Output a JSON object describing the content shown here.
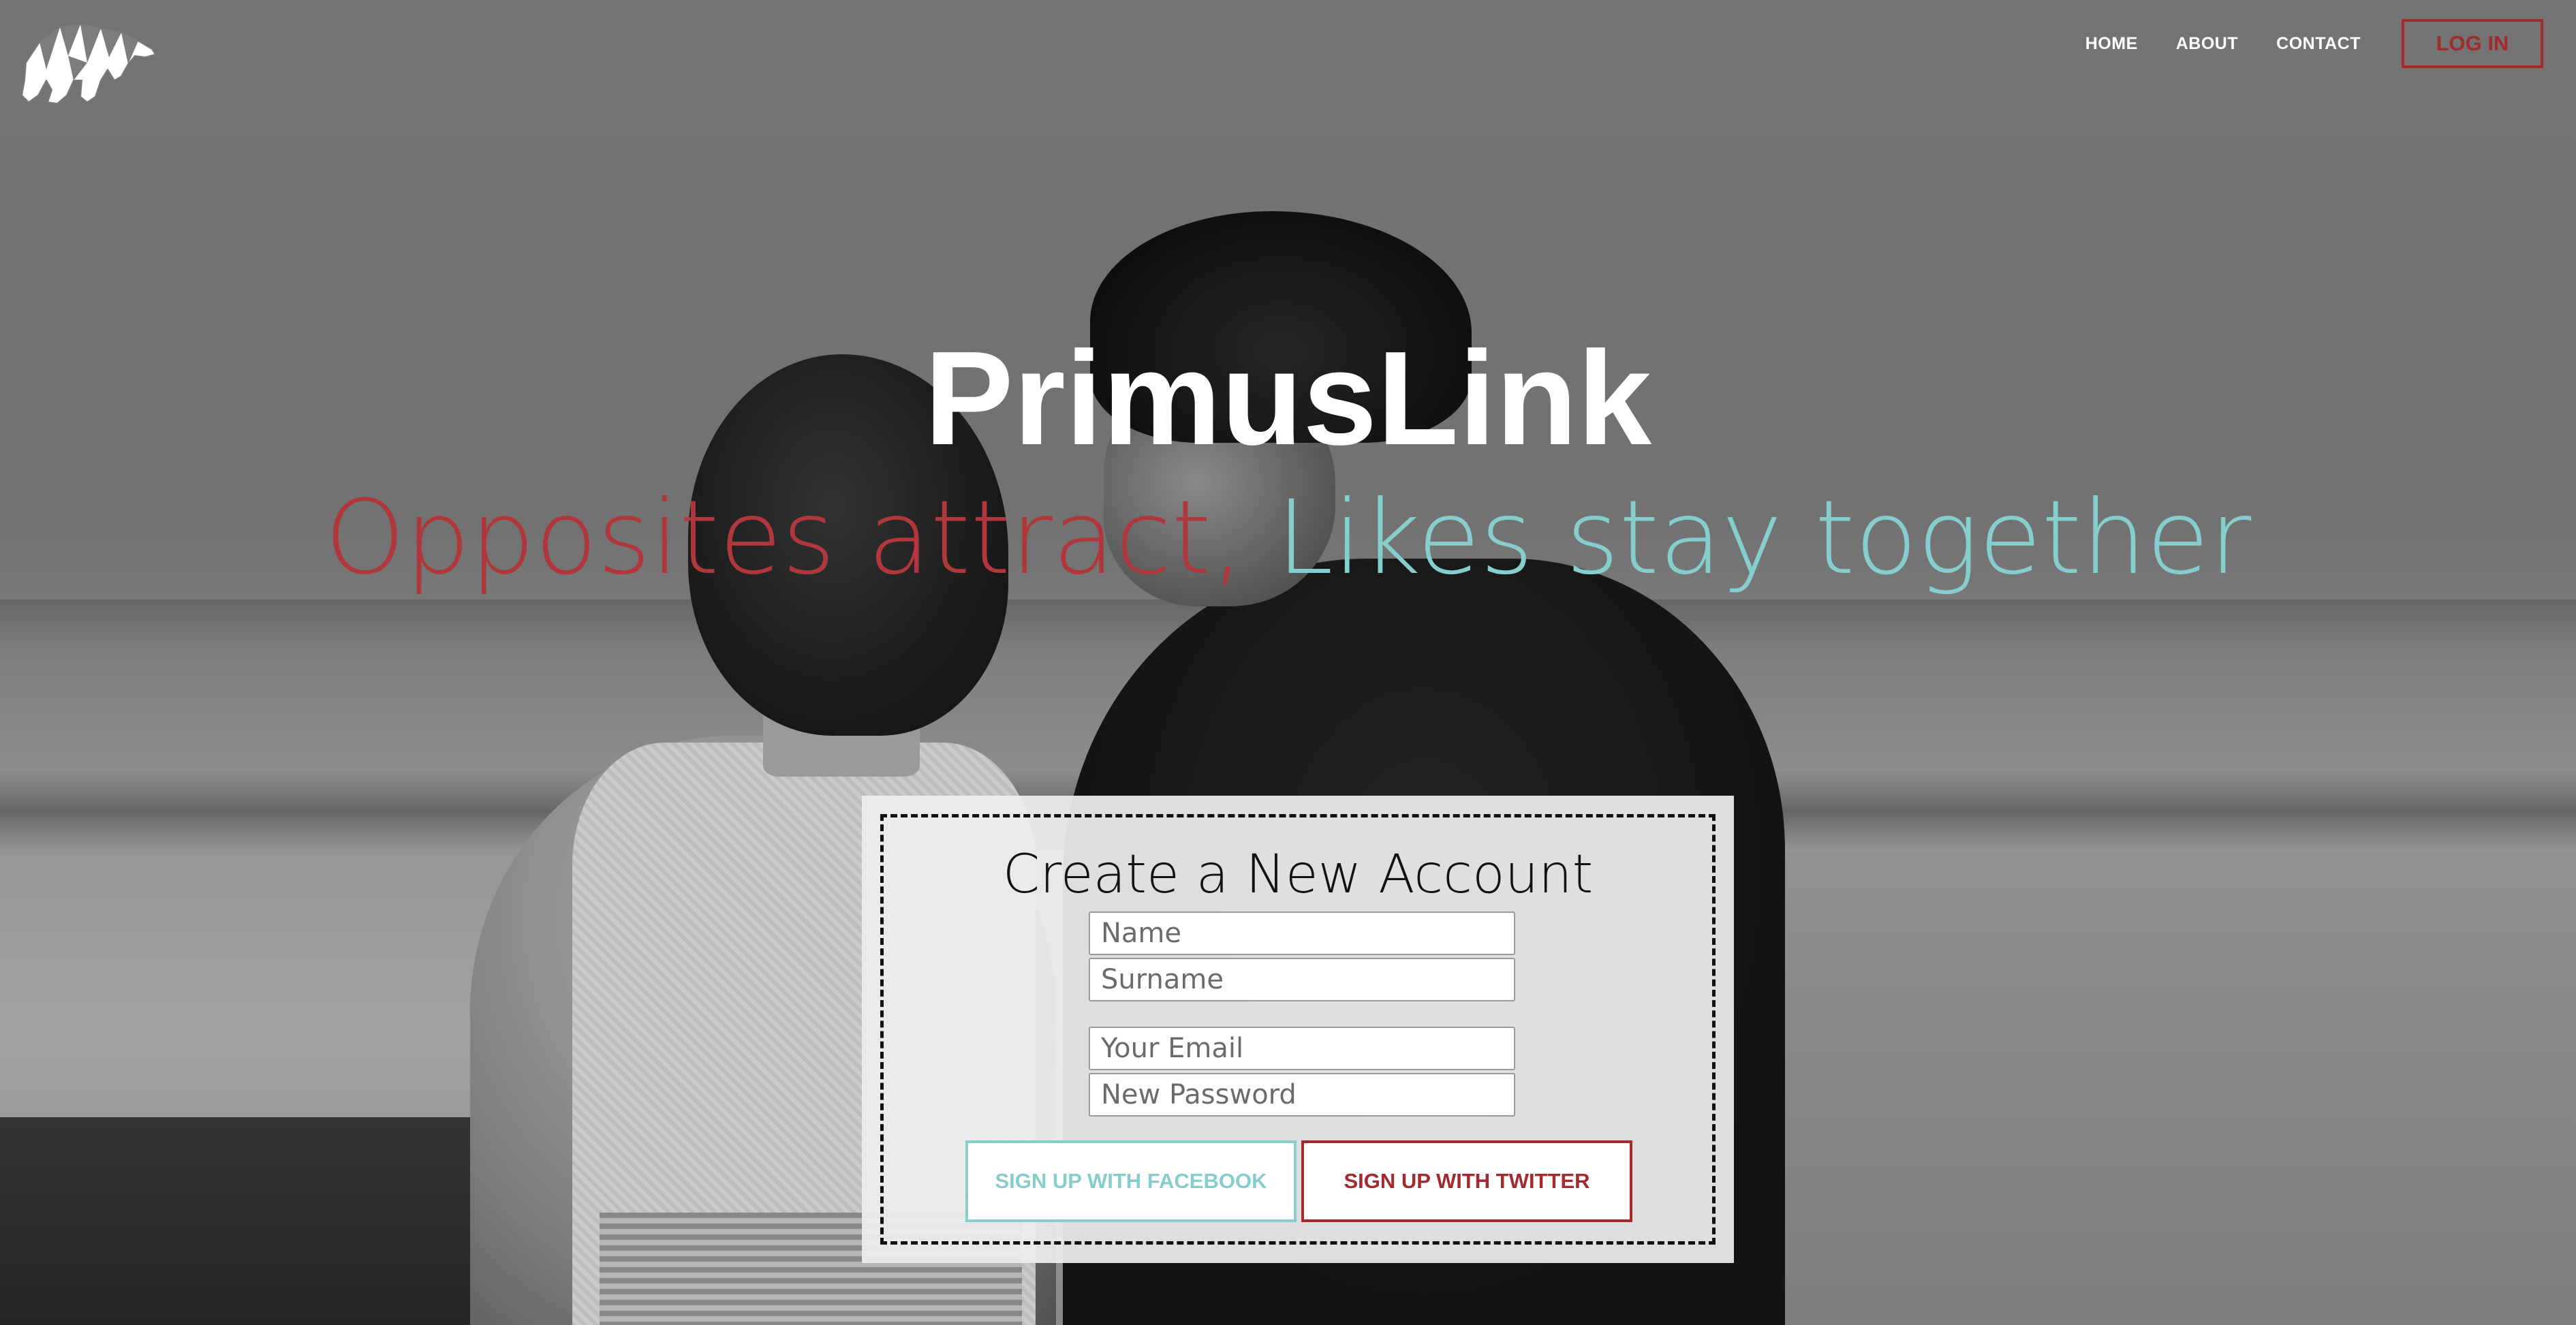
{
  "nav": {
    "links": [
      "HOME",
      "ABOUT",
      "CONTACT"
    ],
    "login_label": "LOG IN"
  },
  "hero": {
    "title": "PrimusLink",
    "tagline_part1": "Opposites attract,",
    "tagline_part2": "Likes stay together"
  },
  "signup": {
    "title": "Create a New Account",
    "name_placeholder": "Name",
    "surname_placeholder": "Surname",
    "email_placeholder": "Your Email",
    "password_placeholder": "New Password",
    "facebook_label": "SIGN UP WITH FACEBOOK",
    "twitter_label": "SIGN UP WITH TWITTER"
  },
  "colors": {
    "accent_red": "#a32a2d",
    "tagline_red": "#b0373c",
    "accent_teal": "#86cdcd",
    "hero_text": "#ffffff"
  },
  "icons": {
    "logo": "polar-bear-logo-icon"
  }
}
